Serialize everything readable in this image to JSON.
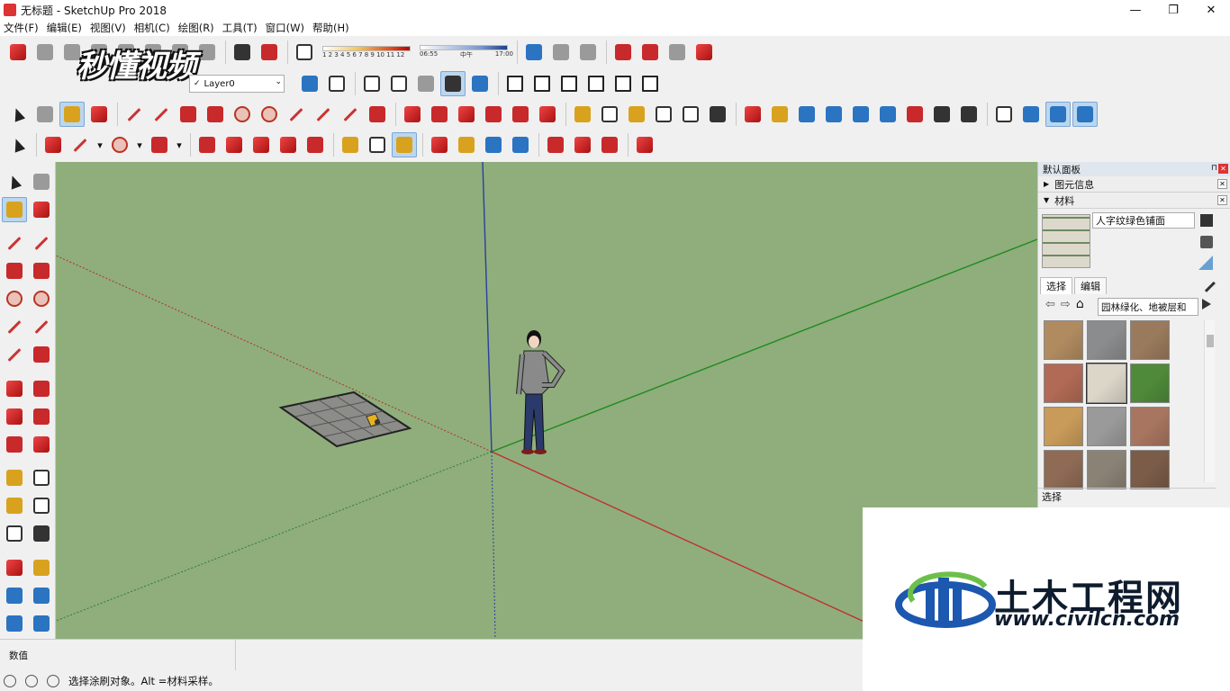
{
  "window": {
    "title": "无标题 - SketchUp Pro 2018",
    "minimize": "—",
    "maximize": "❐",
    "close": "✕"
  },
  "menu": [
    "文件(F)",
    "编辑(E)",
    "视图(V)",
    "相机(C)",
    "绘图(R)",
    "工具(T)",
    "窗口(W)",
    "帮助(H)"
  ],
  "watermark_top": "秒懂视频",
  "layers": {
    "current": "Layer0",
    "check": "✓"
  },
  "shadow": {
    "ticks": "1 2 3 4 5 6 7 8 9 10 11 12",
    "time_start": "06:55",
    "time_mid": "中午",
    "time_end": "17:00"
  },
  "tray": {
    "title": "默认面板",
    "pin": "⊓",
    "panels": [
      {
        "label": "图元信息",
        "arrow": "▶"
      },
      {
        "label": "材料",
        "arrow": "▼"
      }
    ],
    "material_name": "人字纹绿色铺面",
    "tabs": [
      "选择",
      "编辑"
    ],
    "library": "园林绿化、地被层和",
    "nav_back": "⇦",
    "nav_fwd": "⇨",
    "home": "⌂",
    "swatch_colors": [
      "#b08b60",
      "#8a8c8e",
      "#9a7a5c",
      "#b06a55",
      "#dcd6c8",
      "#4f8a3a",
      "#c89b5a",
      "#9a9a9a",
      "#a87560",
      "#8f6b55",
      "#8a8275",
      "#7a5c48"
    ],
    "select_label": "选择"
  },
  "measurements": {
    "label": "数值"
  },
  "status": {
    "hint": "选择涂刷对象。Alt =材料采样。"
  },
  "logo": {
    "cn": "土木工程网",
    "url": "www.civilcn.com"
  },
  "colors": {
    "viewport": "#8fae7c",
    "axis_red": "#c0302c",
    "axis_green": "#1f8a1f",
    "axis_blue": "#2a3f9e"
  }
}
